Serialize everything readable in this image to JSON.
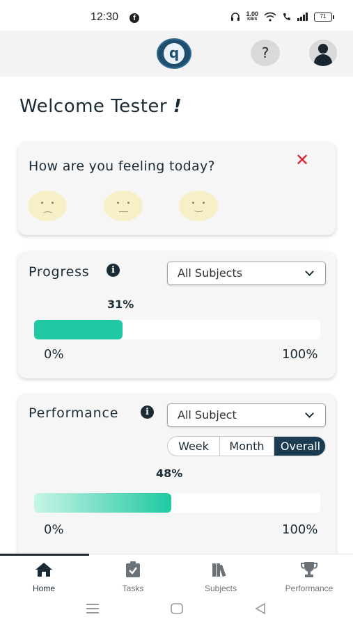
{
  "status_bar": {
    "time": "12:30",
    "net_speed_value": "1.00",
    "net_speed_unit": "KB/S",
    "battery": "71"
  },
  "header": {
    "logo_letter": "q",
    "help_label": "?"
  },
  "welcome": {
    "text": "Welcome Tester ",
    "bang": "!"
  },
  "mood": {
    "question": "How are you feeling today?",
    "close_label": "✕",
    "faces": [
      "sad-face-icon",
      "neutral-face-icon",
      "happy-face-icon"
    ]
  },
  "progress": {
    "title": "Progress",
    "filter": "All Subjects",
    "percent_label": "31%",
    "percent_value": 0.31,
    "min_label": "0%",
    "max_label": "100%"
  },
  "performance": {
    "title": "Performance",
    "filter": "All Subject",
    "tabs": [
      "Week",
      "Month",
      "Overall"
    ],
    "active_tab": "Overall",
    "percent_label": "48%",
    "percent_value": 0.48,
    "min_label": "0%",
    "max_label": "100%"
  },
  "bottom_nav": {
    "items": [
      {
        "label": "Home",
        "icon": "home-icon",
        "active": true
      },
      {
        "label": "Tasks",
        "icon": "clipboard-check-icon",
        "active": false
      },
      {
        "label": "Subjects",
        "icon": "books-icon",
        "active": false
      },
      {
        "label": "Performance",
        "icon": "trophy-icon",
        "active": false
      }
    ]
  },
  "colors": {
    "accent": "#20c9a2",
    "dark": "#1b2b35",
    "close_red": "#e0202a",
    "active_tab": "#1b3b52"
  }
}
